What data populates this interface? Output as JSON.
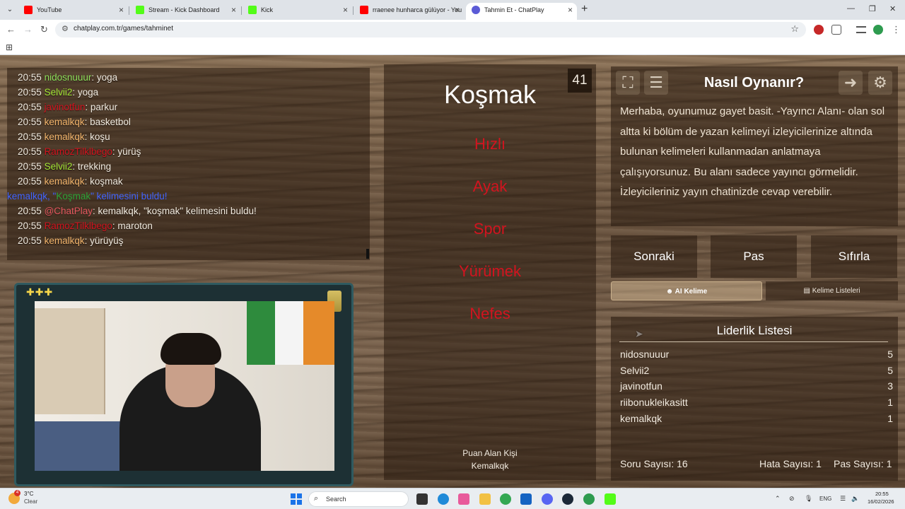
{
  "browser": {
    "tabs": [
      {
        "title": "YouTube",
        "color": "#ff0000"
      },
      {
        "title": "Stream - Kick Dashboard",
        "color": "#53fc18"
      },
      {
        "title": "Kick",
        "color": "#53fc18"
      },
      {
        "title": "rraenee hunharca gülüyor - You",
        "color": "#ff0000"
      },
      {
        "title": "Tahmin Et - ChatPlay",
        "color": "#5b5bd6"
      }
    ],
    "url": "chatplay.com.tr/games/tahminet"
  },
  "chat": {
    "lines": [
      {
        "time": "20:55",
        "user": "nidosnuuur",
        "color": "#8fe05c",
        "msg": ": yoga"
      },
      {
        "time": "20:55",
        "user": "Selvii2",
        "color": "#a3e635",
        "msg": ": yoga"
      },
      {
        "time": "20:55",
        "user": "javinotfun",
        "color": "#d2141f",
        "msg": ": parkur"
      },
      {
        "time": "20:55",
        "user": "kemalkqk",
        "color": "#f2b46b",
        "msg": ": basketbol"
      },
      {
        "time": "20:55",
        "user": "kemalkqk",
        "color": "#f2b46b",
        "msg": ": koşu"
      },
      {
        "time": "20:55",
        "user": "RamozTilklbego",
        "color": "#d2141f",
        "msg": ": yürüş"
      },
      {
        "time": "20:55",
        "user": "Selvii2",
        "color": "#a3e635",
        "msg": ": trekking"
      },
      {
        "time": "20:55",
        "user": "kemalkqk",
        "color": "#f2b46b",
        "msg": ": koşmak"
      }
    ],
    "found_notice": {
      "user": "kemalkqk, \"",
      "word": "Koşmak",
      "rest": "\" kelimesini buldu!"
    },
    "lines2": [
      {
        "time": "20:55",
        "user": "@ChatPlay",
        "color": "#e5585f",
        "msg": ": kemalkqk, \"koşmak\" kelimesini buldu!"
      },
      {
        "time": "20:55",
        "user": "RamozTilklbego",
        "color": "#d2141f",
        "msg": ": maroton"
      },
      {
        "time": "20:55",
        "user": "kemalkqk",
        "color": "#f2b46b",
        "msg": ": yürüyüş"
      }
    ]
  },
  "game": {
    "counter": "41",
    "word": "Koşmak",
    "forbidden": [
      "Hızlı",
      "Ayak",
      "Spor",
      "Yürümek",
      "Nefes"
    ],
    "asker_label": "Puan Alan Kişi",
    "asker_name": "Kemalkqk"
  },
  "info": {
    "title": "Nasıl Oynanır?",
    "text": "Merhaba, oyunumuz gayet basit. -Yayıncı Alanı- olan sol altta ki bölüm de yazan kelimeyi izleyicilerinize altında bulunan kelimeleri kullanmadan anlatmaya çalışıyorsunuz. Bu alanı sadece yayıncı görmelidir. İzleyicileriniz yayın chatinizde cevap verebilir."
  },
  "controls": {
    "next": "Sonraki",
    "pass": "Pas",
    "reset": "Sıfırla",
    "ai_word": "AI Kelime",
    "word_lists": "Kelime Listeleri"
  },
  "leaderboard": {
    "title": "Liderlik Listesi",
    "rows": [
      {
        "name": "nidosnuuur",
        "score": "5"
      },
      {
        "name": "Selvii2",
        "score": "5"
      },
      {
        "name": "javinotfun",
        "score": "3"
      },
      {
        "name": "riibonukleikasitt",
        "score": "1"
      },
      {
        "name": "kemalkqk",
        "score": "1"
      }
    ],
    "question_count": "Soru Sayısı: 16",
    "error_count": "Hata Sayısı: 1",
    "pass_count": "Pas Sayısı: 1"
  },
  "taskbar": {
    "weather_temp": "3°C",
    "weather_desc": "Clear",
    "weather_badge": "4",
    "search": "Search",
    "lang": "ENG",
    "time": "20:55",
    "date": "16/02/2026"
  }
}
